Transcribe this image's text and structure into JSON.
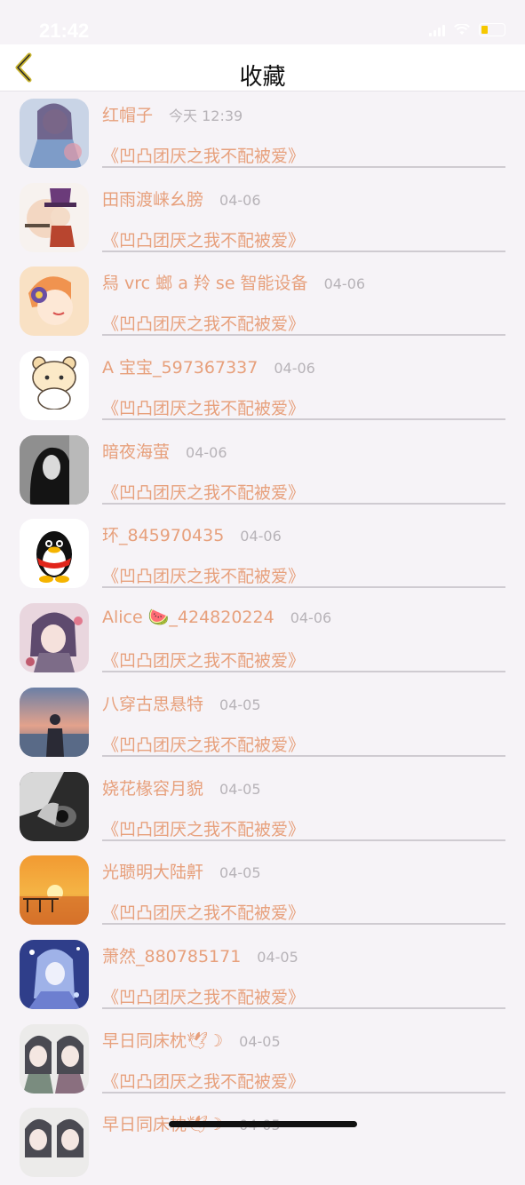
{
  "status_bar": {
    "time": "21:42",
    "battery_color": "#f6c800"
  },
  "header": {
    "title": "收藏",
    "back_icon": "chevron-left-icon",
    "accent": "#c9b530"
  },
  "colors": {
    "text_accent": "#e7a07c",
    "date_gray": "#b7b3b8",
    "background": "#f6f3f7"
  },
  "items": [
    {
      "name": "红帽子",
      "date": "今天 12:39",
      "work": "《凹凸团厌之我不配被爱》",
      "avatar": "avatar-anime-girl"
    },
    {
      "name": "田雨渡崃幺膀",
      "date": "04-06",
      "work": "《凹凸团厌之我不配被爱》",
      "avatar": "avatar-chibi-hat"
    },
    {
      "name": "舄 vrc 螂 a 羚 se 智能设备",
      "date": "04-06",
      "work": "《凹凸团厌之我不配被爱》",
      "avatar": "avatar-flower-girl"
    },
    {
      "name": "A 宝宝_597367337",
      "date": "04-06",
      "work": "《凹凸团厌之我不配被爱》",
      "avatar": "avatar-cartoon-bear"
    },
    {
      "name": "暗夜海萤",
      "date": "04-06",
      "work": "《凹凸团厌之我不配被爱》",
      "avatar": "avatar-dark-portrait"
    },
    {
      "name": "环_845970435",
      "date": "04-06",
      "work": "《凹凸团厌之我不配被爱》",
      "avatar": "avatar-penguin"
    },
    {
      "name": "Alice 🍉_424820224",
      "date": "04-06",
      "work": "《凹凸团厌之我不配被爱》",
      "avatar": "avatar-anime-purple"
    },
    {
      "name": "八穿古思悬特",
      "date": "04-05",
      "work": "《凹凸团厌之我不配被爱》",
      "avatar": "avatar-sunset-person"
    },
    {
      "name": "娆花椽容月貌",
      "date": "04-05",
      "work": "《凹凸团厌之我不配被爱》",
      "avatar": "avatar-bw-camera"
    },
    {
      "name": "光聩明大陆鼾",
      "date": "04-05",
      "work": "《凹凸团厌之我不配被爱》",
      "avatar": "avatar-sunset-sea"
    },
    {
      "name": "萧然_880785171",
      "date": "04-05",
      "work": "《凹凸团厌之我不配被爱》",
      "avatar": "avatar-anime-blue"
    },
    {
      "name": "早日同床枕🕊☽",
      "date": "04-05",
      "work": "《凹凸团厌之我不配被爱》",
      "avatar": "avatar-anime-duo"
    },
    {
      "name": "早日同床枕🕊☽",
      "date": "04-05",
      "work": "",
      "avatar": "avatar-anime-duo"
    }
  ]
}
